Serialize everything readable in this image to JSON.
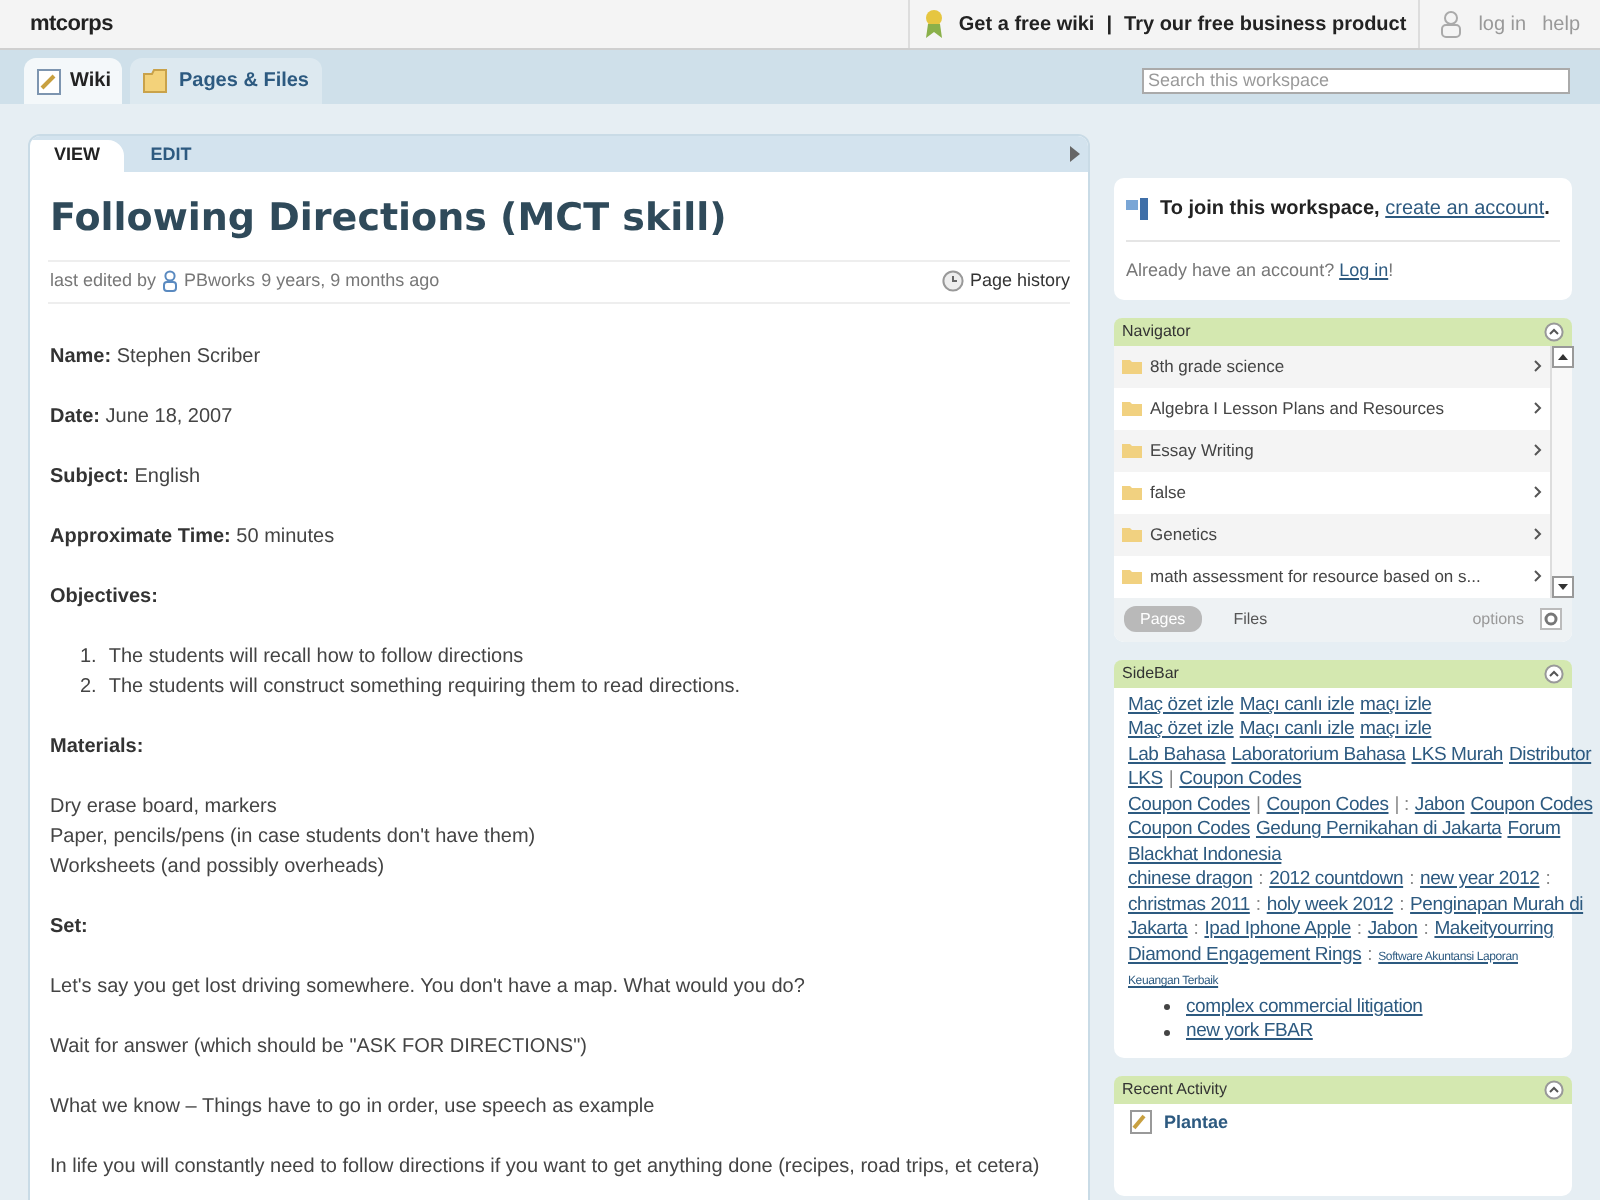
{
  "topbar": {
    "workspace": "mtcorps",
    "links": [
      "Get a free wiki",
      "Try our free business product"
    ],
    "separator": "|",
    "account_links": [
      "log in",
      "help"
    ]
  },
  "tabs": [
    {
      "label": "Wiki",
      "selected": true
    },
    {
      "label": "Pages & Files",
      "selected": false
    }
  ],
  "search": {
    "placeholder": "Search this workspace"
  },
  "page_tabs": [
    {
      "label": "VIEW",
      "selected": true
    },
    {
      "label": "EDIT",
      "selected": false
    }
  ],
  "page": {
    "title": "Following Directions (MCT skill)",
    "edited_prefix": "last edited by",
    "editor": "PBworks",
    "edited_time": "9 years, 9 months ago",
    "history": "Page history",
    "blocks": [
      {
        "kind": "field",
        "label": "Name:",
        "text": "Stephen Scriber"
      },
      {
        "kind": "field",
        "label": "Date:",
        "text": "June 18, 2007"
      },
      {
        "kind": "field",
        "label": "Subject:",
        "text": "English"
      },
      {
        "kind": "field",
        "label": "Approximate Time:",
        "text": "50 minutes"
      },
      {
        "kind": "heading",
        "text": "Objectives:"
      },
      {
        "kind": "list",
        "items": [
          {
            "number": "1.",
            "text": "The students will recall how to follow directions"
          },
          {
            "number": "2.",
            "text": "The students will construct something requiring them to read directions."
          }
        ]
      },
      {
        "kind": "heading",
        "text": "Materials:"
      },
      {
        "kind": "lines",
        "items": [
          "Dry erase board, markers",
          "Paper, pencils/pens (in case students don't have them)",
          "Worksheets (and possibly overheads)"
        ]
      },
      {
        "kind": "heading",
        "text": "Set:"
      },
      {
        "kind": "para",
        "text": "Let's say you get lost driving somewhere. You don't have a map. What would you do?"
      },
      {
        "kind": "para",
        "text": "Wait for answer (which should be \"ASK FOR DIRECTIONS\")"
      },
      {
        "kind": "para",
        "text": "What we know – Things have to go in order, use speech as example"
      },
      {
        "kind": "para",
        "text": "In life you will constantly need to follow directions if you want to get anything done (recipes, road trips, et cetera)"
      }
    ]
  },
  "join": {
    "text": "To join this workspace,",
    "link": "create an account",
    "end": ".",
    "login_text": "Already have an account?",
    "login_link": "Log in",
    "login_end": "!"
  },
  "navigator": {
    "title": "Navigator",
    "items": [
      "8th grade science",
      "Algebra I Lesson Plans and Resources",
      "Essay Writing",
      "false",
      "Genetics",
      "math assessment for resource based on s..."
    ],
    "tabs": [
      {
        "label": "Pages",
        "selected": true
      },
      {
        "label": "Files",
        "selected": false
      }
    ],
    "options": "options"
  },
  "sidebar": {
    "title": "SideBar",
    "lines": [
      [
        {
          "kind": "link",
          "text": "Maç özet izle"
        },
        {
          "kind": "link",
          "text": "Maçı canlı izle"
        },
        {
          "kind": "link",
          "text": "maçı izle"
        }
      ],
      [
        {
          "kind": "link",
          "text": "Maç özet izle"
        },
        {
          "kind": "link",
          "text": "Maçı canlı izle"
        },
        {
          "kind": "link",
          "text": "maçı izle"
        }
      ],
      [
        {
          "kind": "link",
          "text": "Lab Bahasa"
        },
        {
          "kind": "link",
          "text": "Laboratorium Bahasa"
        },
        {
          "kind": "link",
          "text": "LKS Murah"
        },
        {
          "kind": "link",
          "text": "Distributor"
        }
      ],
      [
        {
          "kind": "link",
          "text": "LKS"
        },
        {
          "kind": "sep",
          "text": "|"
        },
        {
          "kind": "link",
          "text": "Coupon Codes"
        }
      ],
      [
        {
          "kind": "link",
          "text": "Coupon Codes"
        },
        {
          "kind": "sep",
          "text": "|"
        },
        {
          "kind": "link",
          "text": "Coupon Codes"
        },
        {
          "kind": "sep",
          "text": "| :"
        },
        {
          "kind": "link",
          "text": "Jabon"
        },
        {
          "kind": "link",
          "text": "Coupon Codes"
        }
      ],
      [
        {
          "kind": "link",
          "text": "Coupon Codes"
        },
        {
          "kind": "link",
          "text": "Gedung Pernikahan di Jakarta"
        },
        {
          "kind": "link",
          "text": "Forum"
        }
      ],
      [
        {
          "kind": "link",
          "text": "Blackhat Indonesia"
        }
      ],
      [
        {
          "kind": "link",
          "text": "chinese dragon"
        },
        {
          "kind": "sep",
          "text": ":"
        },
        {
          "kind": "link",
          "text": "2012 countdown"
        },
        {
          "kind": "sep",
          "text": ":"
        },
        {
          "kind": "link",
          "text": "new year 2012"
        },
        {
          "kind": "sep",
          "text": ":"
        }
      ],
      [
        {
          "kind": "link",
          "text": "christmas 2011"
        },
        {
          "kind": "sep",
          "text": ":"
        },
        {
          "kind": "link",
          "text": "holy week 2012"
        },
        {
          "kind": "sep",
          "text": ":"
        },
        {
          "kind": "link",
          "text": "Penginapan Murah di"
        }
      ],
      [
        {
          "kind": "link",
          "text": "Jakarta"
        },
        {
          "kind": "sep",
          "text": ":"
        },
        {
          "kind": "link",
          "text": "Ipad Iphone Apple"
        },
        {
          "kind": "sep",
          "text": ":"
        },
        {
          "kind": "link",
          "text": "Jabon"
        },
        {
          "kind": "sep",
          "text": ":"
        },
        {
          "kind": "link",
          "text": "Makeityourring"
        }
      ],
      [
        {
          "kind": "link",
          "text": "Diamond Engagement Rings"
        },
        {
          "kind": "sep",
          "text": ":"
        },
        {
          "kind": "small",
          "text": "Software Akuntansi Laporan"
        }
      ],
      [
        {
          "kind": "small",
          "text": "Keuangan Terbaik"
        }
      ]
    ],
    "bullets": [
      "complex commercial litigation",
      "new york FBAR"
    ]
  },
  "recent": {
    "title": "Recent Activity",
    "items": [
      "Plantae"
    ]
  }
}
